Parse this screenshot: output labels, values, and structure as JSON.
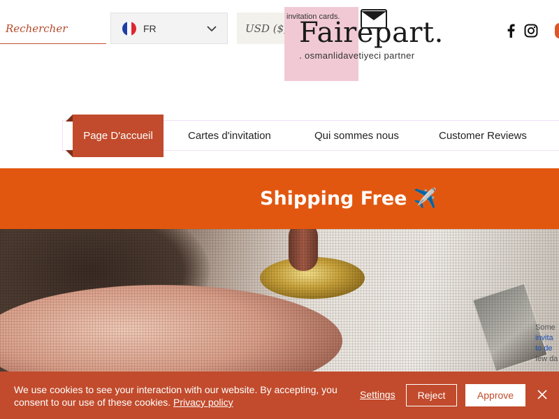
{
  "header": {
    "search_placeholder": "Rechercher",
    "language": {
      "code": "FR",
      "flag": "france-flag-icon"
    },
    "currency": "USD ($)",
    "logo": {
      "small": "invitation cards.",
      "main": "Fairepart.",
      "tagline": ". osmanlidavetiyeci partner"
    },
    "social": [
      "facebook-icon",
      "instagram-icon"
    ]
  },
  "nav": {
    "items": [
      {
        "label": "Page D'accueil",
        "active": true
      },
      {
        "label": "Cartes d'invitation"
      },
      {
        "label": "Qui sommes nous"
      },
      {
        "label": "Customer Reviews"
      }
    ]
  },
  "banner": {
    "text": "Shipping Free ✈️"
  },
  "hero": {
    "snippet": [
      "Some",
      "invita",
      "to de",
      "few da"
    ]
  },
  "cookie": {
    "message": "We use cookies to see your interaction with our website. By accepting, you consent to our use of these cookies.",
    "policy_link": "Privacy policy",
    "settings_label": "Settings",
    "reject_label": "Reject",
    "approve_label": "Approve"
  },
  "colors": {
    "accent": "#c14b2c",
    "banner": "#e2570f",
    "logo_bg": "#f1c9d5"
  }
}
